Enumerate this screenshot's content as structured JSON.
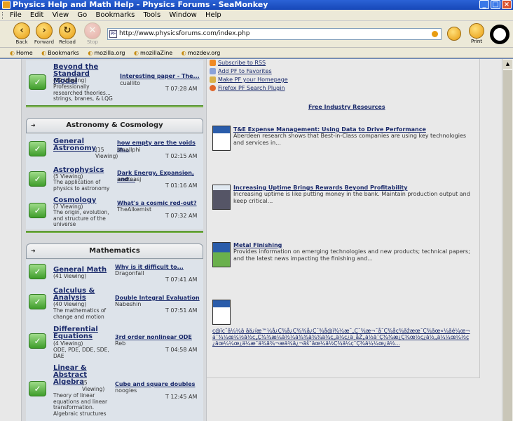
{
  "window": {
    "title": "Physics Help and Math Help - Physics Forums - SeaMonkey"
  },
  "menu": [
    "File",
    "Edit",
    "View",
    "Go",
    "Bookmarks",
    "Tools",
    "Window",
    "Help"
  ],
  "nav": {
    "back": "Back",
    "forward": "Forward",
    "reload": "Reload",
    "stop": "Stop",
    "print": "Print"
  },
  "url": "http://www.physicsforums.com/index.php",
  "bookmarks": [
    "Home",
    "Bookmarks",
    "mozilla.org",
    "mozillaZine",
    "mozdev.org"
  ],
  "forums": {
    "top": {
      "title": "Beyond the Standard Model",
      "viewing": "(12 Viewing)",
      "desc": "Professionally researched theories... strings, branes, & LQG",
      "last_title": "Interesting paper - The...",
      "last_user": "cuallito",
      "last_time": "T 07:28 AM"
    },
    "astro": {
      "header": "Astronomy & Cosmology",
      "items": [
        {
          "title": "General Astronomy",
          "viewing": "(15 Viewing)",
          "desc": "",
          "last_title": "how empty are the voids in...",
          "last_user": "smallphi",
          "last_time": "T 02:15 AM"
        },
        {
          "title": "Astrophysics",
          "viewing": "(5 Viewing)",
          "desc": "The application of physics to astronomy",
          "last_title": "Dark Energy, Expansion, and...",
          "last_user": "andreasj",
          "last_time": "T 01:16 AM"
        },
        {
          "title": "Cosmology",
          "viewing": "(7 Viewing)",
          "desc": "The origin, evolution, and structure of the universe",
          "last_title": "What's a cosmic red-out?",
          "last_user": "TheAlkemist",
          "last_time": "T 07:32 AM"
        }
      ]
    },
    "math": {
      "header": "Mathematics",
      "items": [
        {
          "title": "General Math",
          "viewing": "(41 Viewing)",
          "desc": "",
          "last_title": "Why is it difficult to...",
          "last_user": "Dragonfall",
          "last_time": "T 07:41 AM"
        },
        {
          "title": "Calculus & Analysis",
          "viewing": "(40 Viewing)",
          "desc": "The mathematics of change and motion",
          "last_title": "Double Integral Evaluation",
          "last_user": "Nabeshin",
          "last_time": "T 07:51 AM"
        },
        {
          "title": "Differential Equations",
          "viewing": "(4 Viewing)",
          "desc": "ODE, PDE, DDE, SDE, DAE",
          "last_title": "3rd order nonlinear ODE",
          "last_user": "Reb",
          "last_time": "T 04:58 AM"
        },
        {
          "title": "Linear & Abstract Algebra",
          "viewing": "(5 Viewing)",
          "desc": "Theory of linear equations and linear transformation. Algebraic structures",
          "last_title": "Cube and square doubles",
          "last_user": "noogies",
          "last_time": "T 12:45 AM"
        }
      ]
    }
  },
  "right": {
    "links": [
      "Subscribe to RSS",
      "Add PF to Favorites",
      "Make PF your Homepage",
      "Firefox PF Search Plugin"
    ],
    "free_resources": "Free Industry Resources",
    "resources": [
      {
        "title": "T&E Expense Management: Using Data to Drive Performance",
        "desc": "Aberdeen research shows that Best-in-Class companies are using key technologies and services in..."
      },
      {
        "title": "Increasing Uptime Brings Rewards Beyond Profitability",
        "desc": "Increasing uptime is like putting money in the bank. Maintain production output and keep critical..."
      },
      {
        "title": "Metal Finishing",
        "desc": "Provides information on emerging technologies and new products; technical papers; and the latest news impacting the finishing and..."
      }
    ],
    "garbled": "ç@ïçˆâ¼¼ä ãä¿íæ™¼å¿Ç¾å¿Ç¾¾å¿Ç¯¾å@ì¾¼æ˜„Ç¯¾æ¬¯å¯Ç¾åç¾ãžæœ¯Ç¾ãœ«¼ãé¼œ¬á¯¾¼œ¼½ã½ç„Ç¾¾æ¼ã½¼ä¾¾ä¾¾ä¾ç„ä¼ç¿ä¸åŽ„ä½ä¯Ç¾¾æ¿Ç¾œ½ç¿ä½„ä¼¼œ¼½ç¿äœ¼¼œ¿ä¼æ¯ä¾ã¾¬æä¾ä¿¬ãš¯äœ¼ä½Ç¾ä¼ç¯Ç¾ä¼¼œ¿ä½..."
  }
}
